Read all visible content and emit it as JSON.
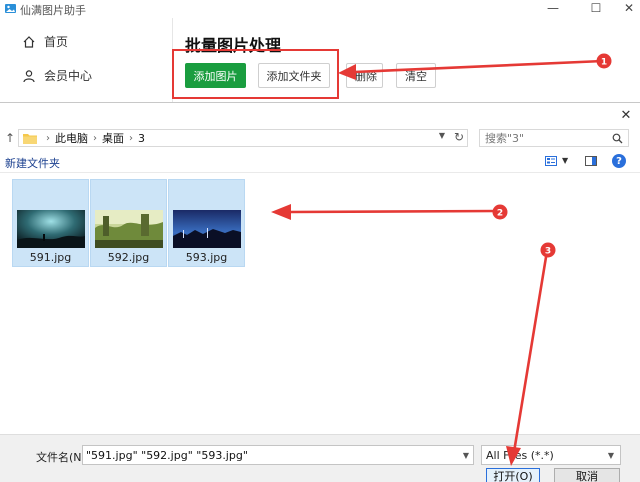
{
  "app": {
    "title": "仙满图片助手",
    "window_controls": {
      "minimize": "—",
      "maximize": "☐",
      "close": "✕"
    },
    "sidebar": [
      {
        "label": "首页",
        "icon": "home-icon"
      },
      {
        "label": "会员中心",
        "icon": "user-icon"
      }
    ],
    "page_title": "批量图片处理",
    "buttons": {
      "add_images": "添加图片",
      "add_folder": "添加文件夹",
      "delete_partial": "删除",
      "clear": "清空"
    },
    "accent_color": "#1a9d3f"
  },
  "dialog": {
    "close": "✕",
    "breadcrumb": [
      "此电脑",
      "桌面",
      "3"
    ],
    "search_placeholder": "搜索\"3\"",
    "new_folder": "新建文件夹",
    "help": "?",
    "files": [
      {
        "name": "591.jpg"
      },
      {
        "name": "592.jpg"
      },
      {
        "name": "593.jpg"
      }
    ],
    "filename_label": "文件名(N):",
    "filename_value": "\"591.jpg\" \"592.jpg\" \"593.jpg\"",
    "filetype_value": "All Files (*.*)",
    "open_button": "打开(O)",
    "cancel_button": "取消"
  },
  "annotations": {
    "markers": [
      "1",
      "2",
      "3"
    ],
    "color": "#e53935"
  }
}
